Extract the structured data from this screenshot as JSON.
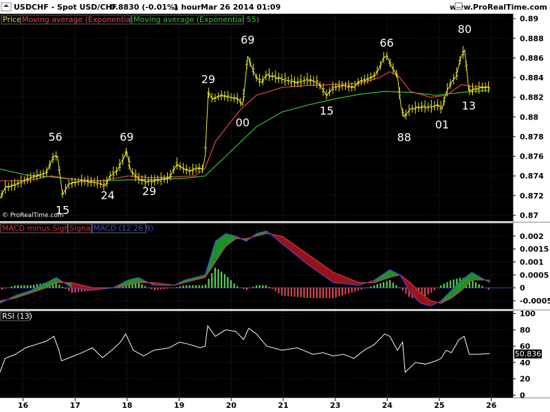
{
  "header": {
    "symbol_text": "USDCHF - Spot USD/CHF",
    "price_text": "0.8830 (-0.01%)",
    "interval_text": "1 hour",
    "date_text": "Mar 26 2014 01:09",
    "site_text": "www.ProRealTime.com"
  },
  "colors": {
    "background": "#000000",
    "price": "#f5f020",
    "ema21": "#e84a4a",
    "ema55": "#36c436",
    "macd_line": "#3a4bd6",
    "macd_signal": "#d8363a",
    "hist_pos": "#55d655",
    "hist_neg": "#e04848",
    "rsi": "#ffffff"
  },
  "chart_data": [
    {
      "type": "line",
      "panel": "price",
      "legend": [
        "Price",
        "Moving average (Exponential 21)",
        "Moving average (Exponential 55)"
      ],
      "watermark": "© ProRealTime.com",
      "yticks": [
        "0.89",
        "0.888",
        "0.886",
        "0.884",
        "0.882",
        "0.88",
        "0.878",
        "0.876",
        "0.874",
        "0.872",
        "0.87"
      ],
      "ylim": [
        0.8694,
        0.8905
      ],
      "x_labels": [
        "16",
        "17",
        "18",
        "19",
        "20",
        "21",
        "23",
        "24",
        "25",
        "26"
      ],
      "annotations": [
        {
          "text": "56",
          "x": 0.108,
          "y": 0.877,
          "pos": "above"
        },
        {
          "text": "15",
          "x": 0.122,
          "y": 0.8714,
          "pos": "below"
        },
        {
          "text": "69",
          "x": 0.247,
          "y": 0.877,
          "pos": "above"
        },
        {
          "text": "24",
          "x": 0.21,
          "y": 0.8729,
          "pos": "below"
        },
        {
          "text": "29",
          "x": 0.291,
          "y": 0.8733,
          "pos": "below"
        },
        {
          "text": "29",
          "x": 0.406,
          "y": 0.8829,
          "pos": "above"
        },
        {
          "text": "00",
          "x": 0.473,
          "y": 0.8803,
          "pos": "below"
        },
        {
          "text": "69",
          "x": 0.483,
          "y": 0.8869,
          "pos": "above"
        },
        {
          "text": "15",
          "x": 0.637,
          "y": 0.8815,
          "pos": "below"
        },
        {
          "text": "66",
          "x": 0.754,
          "y": 0.8866,
          "pos": "above"
        },
        {
          "text": "88",
          "x": 0.788,
          "y": 0.8788,
          "pos": "below"
        },
        {
          "text": "01",
          "x": 0.862,
          "y": 0.8801,
          "pos": "below"
        },
        {
          "text": "13",
          "x": 0.914,
          "y": 0.882,
          "pos": "below"
        },
        {
          "text": "80",
          "x": 0.906,
          "y": 0.888,
          "pos": "above"
        }
      ],
      "series": [
        {
          "name": "Price",
          "x": [
            0.0,
            0.01,
            0.03,
            0.05,
            0.07,
            0.09,
            0.105,
            0.112,
            0.122,
            0.135,
            0.16,
            0.19,
            0.205,
            0.215,
            0.228,
            0.24,
            0.247,
            0.255,
            0.27,
            0.285,
            0.3,
            0.33,
            0.345,
            0.355,
            0.37,
            0.385,
            0.395,
            0.4,
            0.406,
            0.415,
            0.43,
            0.45,
            0.465,
            0.473,
            0.478,
            0.483,
            0.49,
            0.5,
            0.51,
            0.52,
            0.54,
            0.56,
            0.58,
            0.6,
            0.62,
            0.637,
            0.65,
            0.67,
            0.69,
            0.7,
            0.715,
            0.73,
            0.74,
            0.748,
            0.754,
            0.765,
            0.775,
            0.782,
            0.788,
            0.8,
            0.82,
            0.84,
            0.855,
            0.862,
            0.87,
            0.88,
            0.89,
            0.898,
            0.906,
            0.912,
            0.914,
            0.925,
            0.94,
            0.955
          ],
          "values": [
            0.8717,
            0.8728,
            0.8731,
            0.8736,
            0.874,
            0.8743,
            0.876,
            0.876,
            0.8721,
            0.8732,
            0.8735,
            0.8733,
            0.873,
            0.874,
            0.8745,
            0.8757,
            0.8765,
            0.8745,
            0.8737,
            0.8734,
            0.8735,
            0.8738,
            0.8752,
            0.8748,
            0.8745,
            0.8748,
            0.8747,
            0.876,
            0.8825,
            0.8818,
            0.8822,
            0.882,
            0.8818,
            0.8812,
            0.8835,
            0.8862,
            0.8852,
            0.884,
            0.8835,
            0.8843,
            0.884,
            0.8837,
            0.8835,
            0.8838,
            0.8835,
            0.8822,
            0.883,
            0.8832,
            0.883,
            0.8836,
            0.8838,
            0.8842,
            0.885,
            0.886,
            0.8862,
            0.885,
            0.8842,
            0.881,
            0.88,
            0.8808,
            0.881,
            0.881,
            0.8812,
            0.8808,
            0.8825,
            0.8835,
            0.8842,
            0.886,
            0.8868,
            0.8838,
            0.8827,
            0.8828,
            0.883,
            0.883
          ]
        },
        {
          "name": "Moving average (Exponential 21)",
          "x": [
            0.0,
            0.05,
            0.1,
            0.15,
            0.2,
            0.25,
            0.3,
            0.38,
            0.4,
            0.42,
            0.45,
            0.47,
            0.5,
            0.55,
            0.6,
            0.65,
            0.7,
            0.74,
            0.76,
            0.78,
            0.8,
            0.84,
            0.87,
            0.9,
            0.92,
            0.955
          ],
          "values": [
            0.8735,
            0.8735,
            0.874,
            0.8736,
            0.8735,
            0.874,
            0.8738,
            0.874,
            0.8748,
            0.8775,
            0.8795,
            0.8808,
            0.8822,
            0.883,
            0.8832,
            0.8833,
            0.8834,
            0.884,
            0.8846,
            0.884,
            0.8826,
            0.882,
            0.8822,
            0.8833,
            0.8831,
            0.883
          ]
        },
        {
          "name": "Moving average (Exponential 55)",
          "x": [
            0.0,
            0.05,
            0.1,
            0.15,
            0.2,
            0.25,
            0.3,
            0.37,
            0.4,
            0.42,
            0.45,
            0.5,
            0.55,
            0.6,
            0.65,
            0.7,
            0.75,
            0.8,
            0.85,
            0.9,
            0.955
          ],
          "values": [
            0.8747,
            0.8741,
            0.8739,
            0.8736,
            0.8735,
            0.8736,
            0.8736,
            0.8738,
            0.874,
            0.875,
            0.8765,
            0.879,
            0.8805,
            0.8812,
            0.8818,
            0.8823,
            0.8826,
            0.8825,
            0.8822,
            0.8825,
            0.8827
          ]
        }
      ]
    },
    {
      "type": "line",
      "panel": "macd",
      "legend": [
        "MACD minus Signal",
        "Signal",
        "MACD (12 26 9)"
      ],
      "yticks": [
        "0.002",
        "0.0015",
        "0.001",
        "0.0005",
        "0",
        "-0.0005"
      ],
      "ylim": [
        -0.00082,
        0.0025
      ],
      "series": [
        {
          "name": "MACD (12 26 9)",
          "x": [
            0.0,
            0.03,
            0.06,
            0.09,
            0.11,
            0.14,
            0.18,
            0.22,
            0.25,
            0.27,
            0.3,
            0.34,
            0.36,
            0.38,
            0.4,
            0.42,
            0.44,
            0.46,
            0.48,
            0.5,
            0.52,
            0.55,
            0.6,
            0.65,
            0.7,
            0.73,
            0.76,
            0.78,
            0.8,
            0.82,
            0.84,
            0.86,
            0.88,
            0.9,
            0.92,
            0.955
          ],
          "values": [
            -0.0006,
            -0.0003,
            -0.0001,
            0.0002,
            0.0004,
            0.0,
            -0.0001,
            0.0,
            0.0003,
            0.0004,
            0.0001,
            0.0001,
            0.0003,
            0.0004,
            0.0005,
            0.0018,
            0.0021,
            0.002,
            0.0018,
            0.0021,
            0.0022,
            0.0017,
            0.0009,
            0.0002,
            0.0001,
            0.0003,
            0.0007,
            0.0005,
            -0.0002,
            -0.0006,
            -0.0007,
            -0.0005,
            -0.0001,
            0.0003,
            0.0006,
            0.0002
          ]
        },
        {
          "name": "Signal",
          "x": [
            0.0,
            0.03,
            0.06,
            0.09,
            0.11,
            0.14,
            0.18,
            0.22,
            0.25,
            0.27,
            0.3,
            0.34,
            0.36,
            0.38,
            0.4,
            0.42,
            0.44,
            0.46,
            0.48,
            0.5,
            0.52,
            0.55,
            0.6,
            0.65,
            0.7,
            0.73,
            0.76,
            0.78,
            0.8,
            0.82,
            0.84,
            0.86,
            0.88,
            0.9,
            0.92,
            0.955
          ],
          "values": [
            -0.0005,
            -0.0004,
            -0.0002,
            0.0,
            0.0002,
            0.0002,
            0.0,
            0.0,
            0.0001,
            0.0002,
            0.0002,
            0.0001,
            0.0002,
            0.0003,
            0.0004,
            0.001,
            0.0016,
            0.0019,
            0.0019,
            0.002,
            0.0021,
            0.002,
            0.0013,
            0.0006,
            0.0002,
            0.0002,
            0.0004,
            0.0005,
            0.0002,
            -0.0002,
            -0.0005,
            -0.0006,
            -0.0004,
            -0.0001,
            0.0003,
            0.0003
          ]
        },
        {
          "name": "MACD minus Signal",
          "x": [
            0.0,
            0.03,
            0.06,
            0.09,
            0.11,
            0.14,
            0.18,
            0.22,
            0.25,
            0.27,
            0.3,
            0.34,
            0.36,
            0.38,
            0.4,
            0.42,
            0.44,
            0.46,
            0.48,
            0.5,
            0.52,
            0.55,
            0.6,
            0.65,
            0.7,
            0.73,
            0.76,
            0.78,
            0.8,
            0.82,
            0.84,
            0.86,
            0.88,
            0.9,
            0.92,
            0.955
          ],
          "values": [
            -0.0001,
            0.0001,
            0.0001,
            0.0002,
            0.0002,
            -0.0002,
            -0.0001,
            0.0,
            0.0002,
            0.0002,
            -0.0001,
            0.0,
            0.0001,
            0.0001,
            0.0001,
            0.0008,
            0.0005,
            0.0001,
            -0.0001,
            0.0001,
            0.0001,
            -0.0003,
            -0.0004,
            -0.0004,
            -0.0001,
            0.0001,
            0.0003,
            0.0,
            -0.0004,
            -0.0004,
            -0.0002,
            0.0001,
            0.0003,
            0.0004,
            0.0003,
            -0.0001
          ]
        }
      ]
    },
    {
      "type": "line",
      "panel": "rsi",
      "legend": [
        "RSI (13)"
      ],
      "yticks": [
        "100",
        "80",
        "60",
        "40",
        "20",
        "0"
      ],
      "ylim": [
        -3,
        103
      ],
      "last_value_label": "50.836",
      "series": [
        {
          "name": "RSI (13)",
          "x": [
            0.0,
            0.01,
            0.03,
            0.05,
            0.07,
            0.09,
            0.105,
            0.115,
            0.12,
            0.14,
            0.16,
            0.18,
            0.2,
            0.22,
            0.235,
            0.245,
            0.26,
            0.28,
            0.3,
            0.33,
            0.35,
            0.37,
            0.39,
            0.4,
            0.405,
            0.42,
            0.44,
            0.46,
            0.475,
            0.485,
            0.5,
            0.52,
            0.55,
            0.58,
            0.61,
            0.63,
            0.65,
            0.67,
            0.69,
            0.71,
            0.73,
            0.75,
            0.76,
            0.775,
            0.785,
            0.79,
            0.81,
            0.83,
            0.85,
            0.86,
            0.87,
            0.88,
            0.895,
            0.905,
            0.915,
            0.93,
            0.955
          ],
          "values": [
            28,
            45,
            50,
            58,
            62,
            66,
            72,
            55,
            42,
            47,
            52,
            58,
            46,
            56,
            65,
            75,
            55,
            48,
            55,
            58,
            65,
            62,
            58,
            60,
            85,
            72,
            80,
            78,
            68,
            82,
            75,
            60,
            55,
            58,
            50,
            52,
            48,
            50,
            45,
            55,
            62,
            75,
            72,
            55,
            65,
            28,
            40,
            38,
            42,
            45,
            55,
            52,
            68,
            72,
            50,
            50,
            51
          ]
        }
      ]
    }
  ]
}
